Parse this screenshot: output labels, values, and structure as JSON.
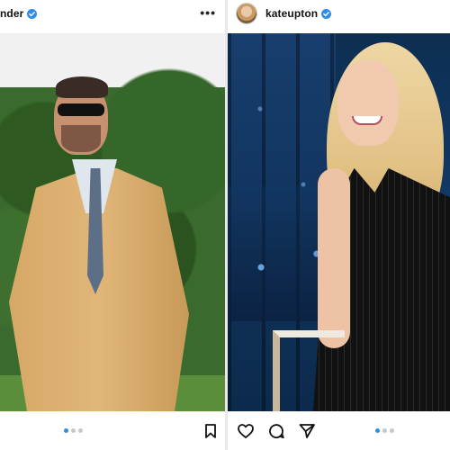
{
  "left_post": {
    "username_visible": "nder",
    "verified_icon": "verified-badge-icon",
    "more_label": "•••",
    "carousel": {
      "total": 3,
      "active_index": 1
    },
    "actions": [
      "save-icon"
    ]
  },
  "right_post": {
    "username": "kateupton",
    "verified_icon": "verified-badge-icon",
    "avatar_icon": "avatar",
    "carousel": {
      "total": 3,
      "active_index": 1
    },
    "actions": [
      "heart-icon",
      "comment-icon",
      "send-icon"
    ]
  },
  "colors": {
    "verified_blue": "#2f8ce8",
    "carousel_active": "#2f8ce8",
    "carousel_inactive": "#c8c8c8"
  }
}
